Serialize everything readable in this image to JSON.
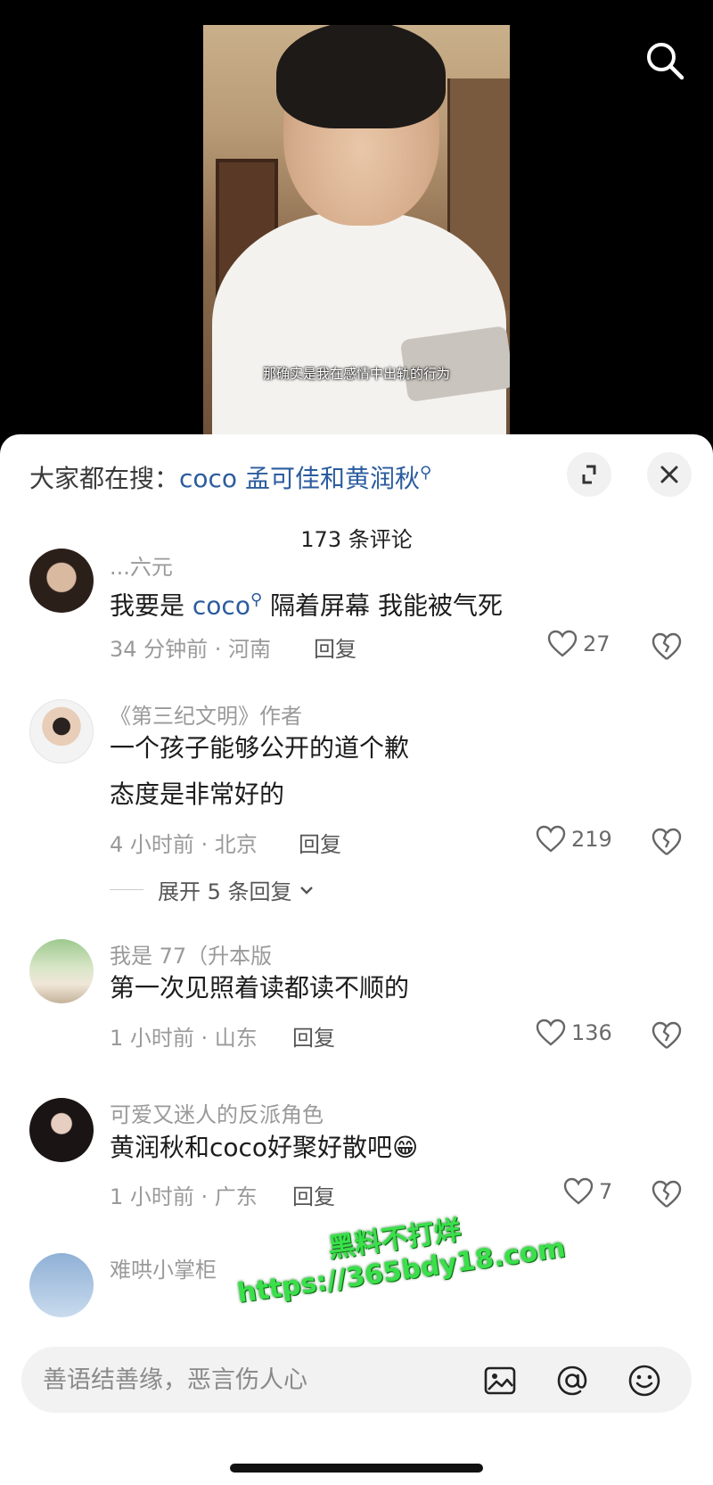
{
  "video": {
    "subtitle": "那确实是我在感情中出轨的行为",
    "search_icon": "search-icon"
  },
  "sheet": {
    "hot_search_prefix": "大家都在搜：",
    "hot_search_keyword": "coco 孟可佳和黄润秋",
    "comment_count": "173 条评论",
    "expand_icon": "expand-icon",
    "close_icon": "close-icon"
  },
  "comments": [
    {
      "username": "...六元",
      "text_keyword": "coco",
      "text_before": "我要是 ",
      "text_after": "  隔着屏幕 我能被气死",
      "meta": "34 分钟前 · 河南",
      "reply_label": "回复",
      "likes": "27"
    },
    {
      "username": "《第三纪文明》作者",
      "text_line1": "一个孩子能够公开的道个歉",
      "text_line2": "态度是非常好的",
      "meta": "4 小时前 · 北京",
      "reply_label": "回复",
      "likes": "219",
      "expand_replies": "展开 5 条回复"
    },
    {
      "username": "我是 77（升本版",
      "text": "第一次见照着读都读不顺的",
      "meta": "1 小时前 · 山东",
      "reply_label": "回复",
      "likes": "136"
    },
    {
      "username": "可爱又迷人的反派角色",
      "text": "黄润秋和coco好聚好散吧😁",
      "meta": "1 小时前 · 广东",
      "reply_label": "回复",
      "likes": "7"
    },
    {
      "username": "难哄小掌柜"
    }
  ],
  "input": {
    "placeholder": "善语结善缘，恶言伤人心",
    "icons": [
      "image-icon",
      "at-icon",
      "emoji-icon"
    ]
  },
  "watermark": {
    "line1": "黑料不打烊",
    "line2": "https://365bdy18.com"
  },
  "colors": {
    "keyword": "#2b5c9e",
    "watermark": "#39e04a"
  }
}
